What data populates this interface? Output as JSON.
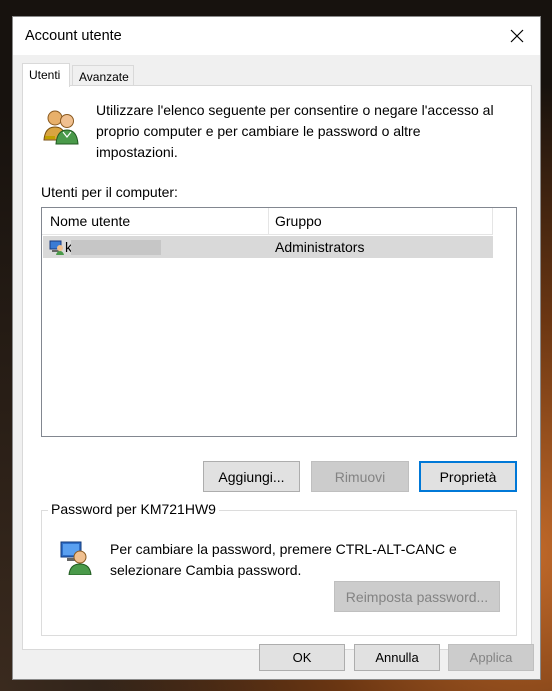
{
  "window": {
    "title": "Account utente"
  },
  "tabs": [
    {
      "label": "Utenti",
      "active": true
    },
    {
      "label": "Avanzate",
      "active": false
    }
  ],
  "users_tab": {
    "intro_text": "Utilizzare l'elenco seguente per consentire o negare l'accesso al proprio computer e per cambiare le password o altre impostazioni.",
    "list_label": "Utenti per il computer:",
    "columns": [
      "Nome utente",
      "Gruppo"
    ],
    "rows": [
      {
        "name": "k",
        "group": "Administrators"
      }
    ],
    "buttons": {
      "add": "Aggiungi...",
      "remove": "Rimuovi",
      "properties": "Proprietà"
    },
    "password_group": {
      "title": "Password per KM721HW9",
      "text": "Per cambiare la password, premere CTRL-ALT-CANC e selezionare Cambia password.",
      "reset_button": "Reimposta password..."
    }
  },
  "footer": {
    "ok": "OK",
    "cancel": "Annulla",
    "apply": "Applica"
  },
  "colors": {
    "accent": "#0078d7",
    "selected_row": "#d9d9d9"
  }
}
